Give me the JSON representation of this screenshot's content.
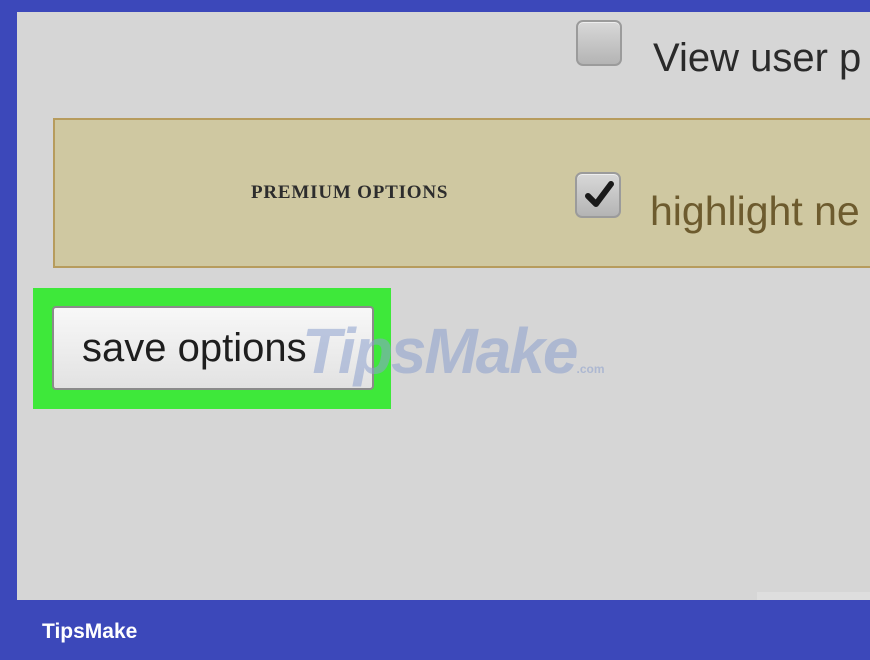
{
  "options": {
    "view_user_label": "View user p",
    "view_user_checked": false,
    "premium_section_title": "PREMIUM OPTIONS",
    "highlight_label": "highlight ne",
    "highlight_checked": true
  },
  "actions": {
    "save_label": "save options"
  },
  "watermark": {
    "text": "TipsMake",
    "suffix": ".com"
  },
  "footer": {
    "brand": "TipsMake"
  },
  "colors": {
    "frame": "#3c48ba",
    "screen_bg": "#d6d6d6",
    "premium_bg": "#cfc8a1",
    "premium_border": "#b79c5d",
    "highlight": "#3ee83a"
  }
}
